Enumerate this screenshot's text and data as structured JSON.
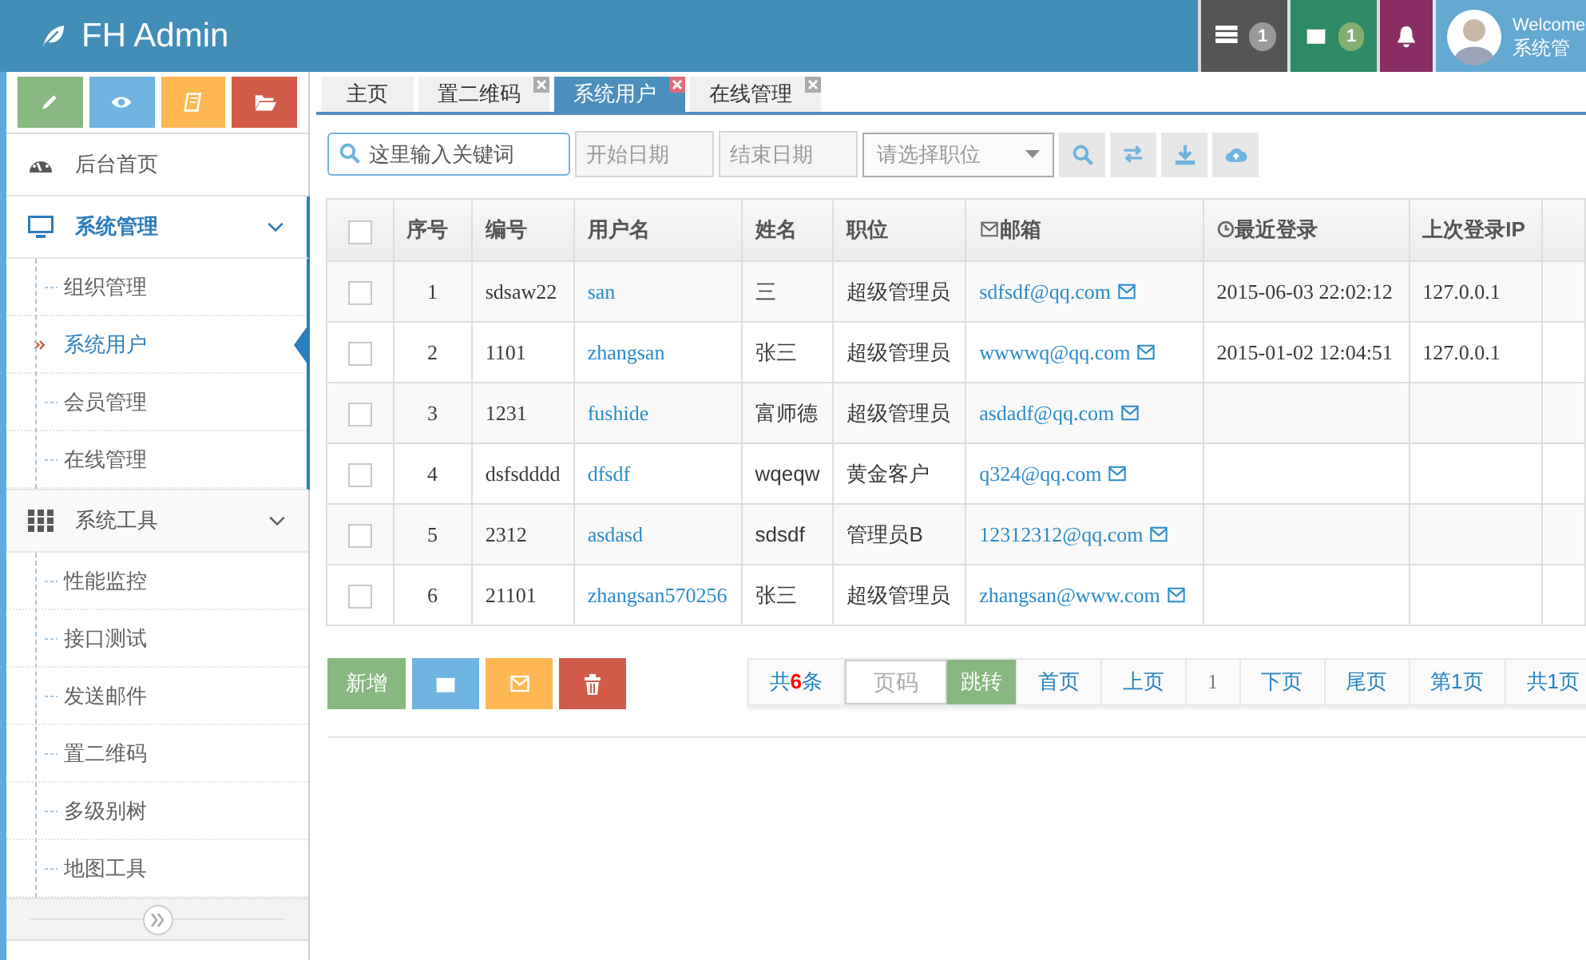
{
  "header": {
    "brand": "FH Admin",
    "notifications": [
      {
        "kind": "tasks",
        "count": "1"
      },
      {
        "kind": "messages",
        "count": "1"
      },
      {
        "kind": "alerts"
      }
    ],
    "user": {
      "welcome": "Welcome",
      "name": "系统管"
    }
  },
  "sidebar": {
    "shortcuts": [
      {
        "kind": "edit"
      },
      {
        "kind": "view"
      },
      {
        "kind": "book"
      },
      {
        "kind": "folder"
      }
    ],
    "menu": [
      {
        "label": "后台首页",
        "selected": false
      },
      {
        "label": "系统管理",
        "selected": true,
        "expanded": true,
        "children": [
          {
            "label": "组织管理",
            "selected": false
          },
          {
            "label": "系统用户",
            "selected": true
          },
          {
            "label": "会员管理",
            "selected": false
          },
          {
            "label": "在线管理",
            "selected": false
          }
        ]
      },
      {
        "label": "系统工具",
        "selected": false,
        "expanded": true,
        "children": [
          {
            "label": "性能监控",
            "selected": false
          },
          {
            "label": "接口测试",
            "selected": false
          },
          {
            "label": "发送邮件",
            "selected": false
          },
          {
            "label": "置二维码",
            "selected": false
          },
          {
            "label": "多级别树",
            "selected": false
          },
          {
            "label": "地图工具",
            "selected": false
          }
        ]
      }
    ]
  },
  "tabs": [
    {
      "label": "主页",
      "selected": false,
      "closable": false
    },
    {
      "label": "置二维码",
      "selected": false,
      "closable": true
    },
    {
      "label": "系统用户",
      "selected": true,
      "closable": true
    },
    {
      "label": "在线管理",
      "selected": false,
      "closable": true
    }
  ],
  "toolbar": {
    "search": {
      "placeholder": "这里输入关键词"
    },
    "start_date": {
      "placeholder": "开始日期"
    },
    "end_date": {
      "placeholder": "结束日期"
    },
    "role_select": {
      "placeholder": "请选择职位"
    },
    "buttons": [
      {
        "kind": "search"
      },
      {
        "kind": "exchange"
      },
      {
        "kind": "download"
      },
      {
        "kind": "upload"
      }
    ]
  },
  "table": {
    "header_checked": false,
    "columns": [
      {
        "label": "序号"
      },
      {
        "label": "编号"
      },
      {
        "label": "用户名"
      },
      {
        "label": "姓名"
      },
      {
        "label": "职位"
      },
      {
        "label": "邮箱"
      },
      {
        "label": "最近登录"
      },
      {
        "label": "上次登录IP"
      }
    ],
    "rows": [
      {
        "checked": false,
        "no": "1",
        "code": "sdsaw22",
        "username": "san",
        "name": "三",
        "role": "超级管理员",
        "email": "sdfsdf@qq.com",
        "last_login": "2015-06-03 22:02:12",
        "last_ip": "127.0.0.1"
      },
      {
        "checked": false,
        "no": "2",
        "code": "1101",
        "username": "zhangsan",
        "name": "张三",
        "role": "超级管理员",
        "email": "wwwwq@qq.com",
        "last_login": "2015-01-02 12:04:51",
        "last_ip": "127.0.0.1"
      },
      {
        "checked": false,
        "no": "3",
        "code": "1231",
        "username": "fushide",
        "name": "富师德",
        "role": "超级管理员",
        "email": "asdadf@qq.com"
      },
      {
        "checked": false,
        "no": "4",
        "code": "dsfsdddd",
        "username": "dfsdf",
        "name": "wqeqw",
        "role": "黄金客户",
        "email": "q324@qq.com"
      },
      {
        "checked": false,
        "no": "5",
        "code": "2312",
        "username": "asdasd",
        "name": "sdsdf",
        "role": "管理员B",
        "email": "12312312@qq.com"
      },
      {
        "checked": false,
        "no": "6",
        "code": "21101",
        "username": "zhangsan570256",
        "name": "张三",
        "role": "超级管理员",
        "email": "zhangsan@www.com"
      }
    ]
  },
  "actions": [
    {
      "kind": "add",
      "label": "新增"
    },
    {
      "kind": "message"
    },
    {
      "kind": "email"
    },
    {
      "kind": "delete"
    }
  ],
  "pagination": {
    "total": "共**6**条",
    "page_input": {
      "placeholder": "页码"
    },
    "jump": "跳转",
    "links": [
      {
        "label": "首页",
        "kind": "link"
      },
      {
        "label": "上页",
        "kind": "link"
      },
      {
        "label": "1",
        "kind": "current"
      },
      {
        "label": "下页",
        "kind": "link"
      },
      {
        "label": "尾页",
        "kind": "link"
      },
      {
        "label": "第1页",
        "kind": "link"
      },
      {
        "label": "共1页",
        "kind": "link"
      }
    ]
  }
}
